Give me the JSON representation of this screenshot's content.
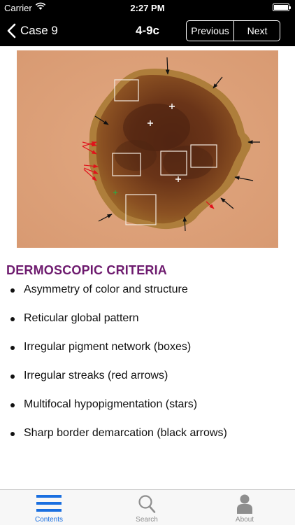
{
  "status_bar": {
    "carrier": "Carrier",
    "time": "2:27 PM"
  },
  "nav": {
    "back_label": "Case 9",
    "title": "4-9c",
    "previous_label": "Previous",
    "next_label": "Next"
  },
  "figure": {
    "icon": "dermoscopy-image"
  },
  "content": {
    "section_title": "DERMOSCOPIC CRITERIA",
    "criteria": [
      "Asymmetry of color and structure",
      "Reticular global pattern",
      "Irregular pigment network (boxes)",
      "Irregular streaks (red arrows)",
      "Multifocal hypopigmentation (stars)",
      "Sharp border demarcation (black arrows)"
    ]
  },
  "tab_bar": {
    "tabs": [
      {
        "label": "Contents",
        "icon": "list-icon",
        "active": true
      },
      {
        "label": "Search",
        "icon": "search-icon",
        "active": false
      },
      {
        "label": "About",
        "icon": "person-icon",
        "active": false
      }
    ]
  },
  "colors": {
    "accent": "#1a6fe0",
    "section_title": "#6d1a6e",
    "bars": "#000000"
  }
}
